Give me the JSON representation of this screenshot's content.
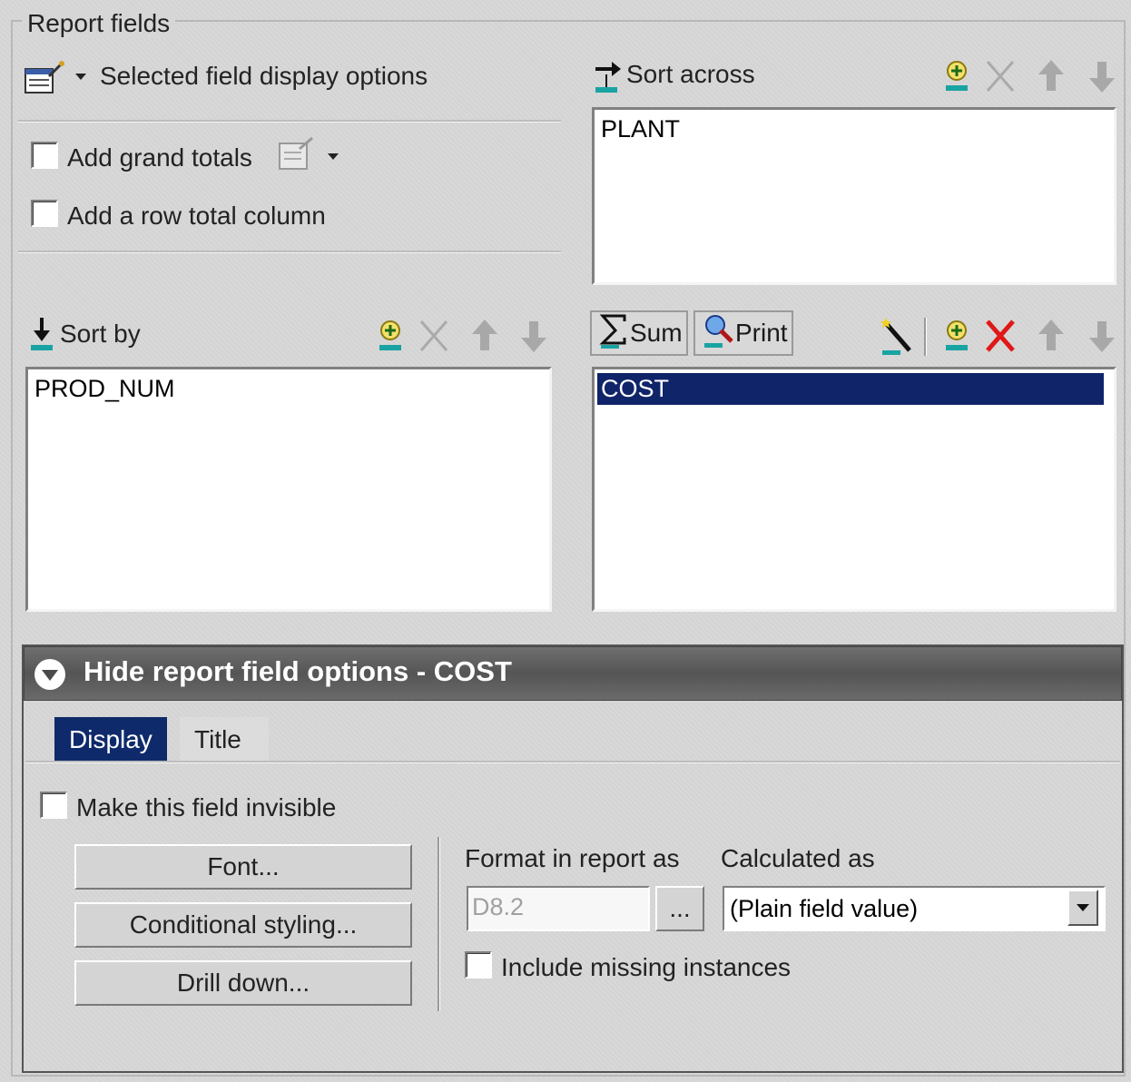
{
  "group": {
    "legend": "Report fields"
  },
  "display_options": {
    "label": "Selected field display options",
    "icon": "properties-icon"
  },
  "checkboxes": {
    "grand_totals": {
      "label": "Add grand totals",
      "checked": false
    },
    "row_total": {
      "label": "Add a row total column",
      "checked": false
    }
  },
  "sort_across": {
    "label": "Sort across",
    "items": [
      "PLANT"
    ]
  },
  "sort_by": {
    "label": "Sort by",
    "items": [
      "PROD_NUM"
    ]
  },
  "measures": {
    "sum_label": "Sum",
    "print_label": "Print",
    "items": [
      "COST"
    ],
    "selected_index": 0
  },
  "field_options": {
    "title": "Hide report field options - COST",
    "tabs": [
      "Display",
      "Title"
    ],
    "active_tab": "Display",
    "invisible_label": "Make this field invisible",
    "buttons": {
      "font": "Font...",
      "conditional": "Conditional styling...",
      "drilldown": "Drill down..."
    },
    "format_label": "Format in report as",
    "format_value": "D8.2",
    "format_browse": "...",
    "calculated_label": "Calculated as",
    "calculated_value": "(Plain field value)",
    "missing_label": "Include missing instances"
  },
  "colors": {
    "selection": "#10246a",
    "panel_bar": "#5f5f5f",
    "active_tab": "#0f2a6b",
    "delete_red": "#e01818"
  }
}
